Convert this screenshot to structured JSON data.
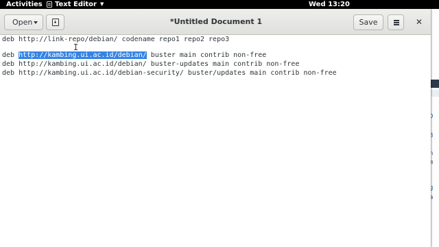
{
  "topbar": {
    "activities": "Activities",
    "app_name": "Text Editor",
    "app_icon": "text-editor-icon",
    "app_menu_icon": "caret-down-icon",
    "clock": "Wed 13:20"
  },
  "headerbar": {
    "open_label": "Open",
    "open_icon": "caret-down-icon",
    "new_tab_icon": "new-document-icon",
    "title": "*Untitled Document 1",
    "save_label": "Save",
    "menu_icon": "hamburger-menu-icon",
    "close_icon": "close-icon"
  },
  "document": {
    "line1": "deb http://link-repo/debian/ codename repo1 repo2 repo3",
    "line2_prefix": "deb ",
    "line2_selected": "http://kambing.ui.ac.id/debian/",
    "line2_suffix": " buster main contrib non-free",
    "line3": "deb http://kambing.ui.ac.id/debian/ buster-updates main contrib non-free",
    "line4": "deb http://kambing.ui.ac.id/debian-security/ buster/updates main contrib non-free"
  },
  "colors": {
    "selection": "#3584e4",
    "headerbar": "#e8e8e7",
    "topbar": "#000000"
  }
}
